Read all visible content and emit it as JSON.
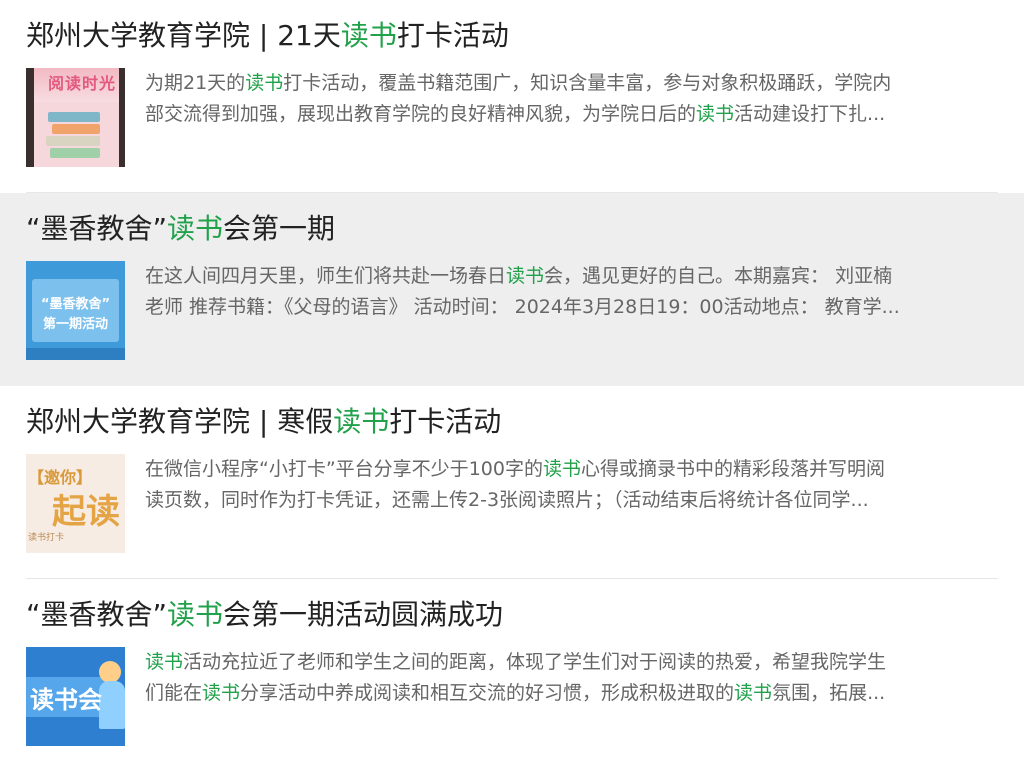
{
  "items": [
    {
      "title": {
        "pre": "郑州大学教育学院 | 21天",
        "kw": "读书",
        "post": "打卡活动"
      },
      "line1": {
        "pre": "为期21天的",
        "kw": "读书",
        "post": "打卡活动，覆盖书籍范围广，知识含量丰富，参与对象积极踊跃，学院内"
      },
      "line2": {
        "pre": "部交流得到加强，展现出教育学院的良好精神风貌，为学院日后的",
        "kw": "读书",
        "post": "活动建设打下扎..."
      },
      "thumb": {
        "title": "阅读时光"
      }
    },
    {
      "title": {
        "pre": "“墨香教舍”",
        "kw": "读书",
        "post": "会第一期"
      },
      "line1": {
        "pre": "在这人间四月天里，师生们将共赴一场春日",
        "kw": "读书",
        "post": "会，遇见更好的自己。本期嘉宾： 刘亚楠"
      },
      "line2": {
        "pre": "老师 推荐书籍：《父母的语言》 活动时间： 2024年3月28日19：00活动地点： 教育学...",
        "kw": "",
        "post": ""
      },
      "thumb": {
        "line1": "“墨香教舍”",
        "line2": "第一期活动"
      }
    },
    {
      "title": {
        "pre": "郑州大学教育学院 | 寒假",
        "kw": "读书",
        "post": "打卡活动"
      },
      "line1": {
        "pre": "在微信小程序“小打卡”平台分享不少于100字的",
        "kw": "读书",
        "post": "心得或摘录书中的精彩段落并写明阅"
      },
      "line2": {
        "pre": "读页数，同时作为打卡凭证，还需上传2-3张阅读照片；（活动结束后将统计各位同学...",
        "kw": "",
        "post": ""
      },
      "thumb": {
        "invite": "【邀你】",
        "big": "起读",
        "small": "读书打卡"
      }
    },
    {
      "title": {
        "pre": "“墨香教舍”",
        "kw": "读书",
        "post": "会第一期活动圆满成功"
      },
      "line1": {
        "pre": "",
        "kw": "读书",
        "post": "活动充拉近了老师和学生之间的距离，体现了学生们对于阅读的热爱，希望我院学生"
      },
      "line2": {
        "pre": "们能在",
        "kw": "读书",
        "post": "分享活动中养成阅读和相互交流的好习惯，形成积极进取的",
        "kw2": "读书",
        "post2": "氛围，拓展..."
      },
      "thumb": {
        "text": "读书会"
      }
    }
  ],
  "colors": {
    "keyword": "#22a14b",
    "title": "#222222",
    "desc": "#666666",
    "highlight_bg": "#eeeeee"
  }
}
